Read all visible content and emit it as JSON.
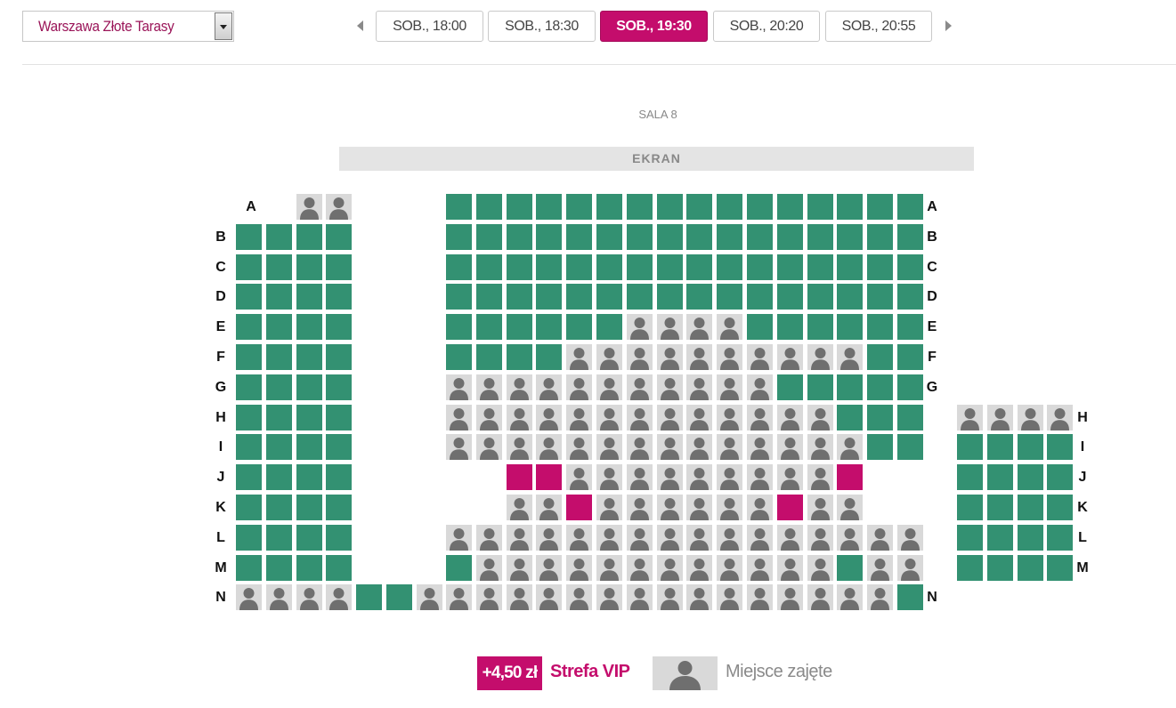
{
  "cinema_select": {
    "value": "Warszawa Złote Tarasy"
  },
  "showtimes": [
    {
      "label": "SOB., 18:00",
      "active": false
    },
    {
      "label": "SOB., 18:30",
      "active": false
    },
    {
      "label": "SOB., 19:30",
      "active": true
    },
    {
      "label": "SOB., 20:20",
      "active": false
    },
    {
      "label": "SOB., 20:55",
      "active": false
    }
  ],
  "hall": {
    "name": "SALA 8",
    "screen_label": "EKRAN"
  },
  "colors": {
    "free": "#339172",
    "vip": "#c40d6c",
    "taken": "#d9d9d9",
    "accent": "#c40d6c"
  },
  "seat_rows": [
    {
      "row": "A",
      "left": "..XX",
      "center": "FFFFFFFFFFFFFFFF",
      "right": ""
    },
    {
      "row": "B",
      "left": "FFFF",
      "center": "FFFFFFFFFFFFFFFF",
      "right": ""
    },
    {
      "row": "C",
      "left": "FFFF",
      "center": "FFFFFFFFFFFFFFFF",
      "right": ""
    },
    {
      "row": "D",
      "left": "FFFF",
      "center": "FFFFFFFFFFFFFFFF",
      "right": ""
    },
    {
      "row": "E",
      "left": "FFFF",
      "center": "FFFFFFXXXXFFFFFF",
      "right": ""
    },
    {
      "row": "F",
      "left": "FFFF",
      "center": "FFFFXXXXXXXXXXFF",
      "right": ""
    },
    {
      "row": "G",
      "left": "FFFF",
      "center": "XXXXXXXXXXXFFFFF",
      "right": ""
    },
    {
      "row": "H",
      "left": "FFFF",
      "center": "XXXXXXXXXXXXXFFF.",
      "right": "XXXX"
    },
    {
      "row": "I",
      "left": "FFFF",
      "center": "XXXXXXXXXXXXXXFF.",
      "right": "FFFF"
    },
    {
      "row": "J",
      "left": "FFFF",
      "center": "..VVXXXXXXXXXV...",
      "right": "FFFF"
    },
    {
      "row": "K",
      "left": "FFFF",
      "center": "..XXVXXXXXXVXX...",
      "right": "FFFF"
    },
    {
      "row": "L",
      "left": "FFFF",
      "center": "XXXXXXXXXXXXXXXX.",
      "right": "FFFF"
    },
    {
      "row": "M",
      "left": "FFFF",
      "center": "FXXXXXXXXXXXXFXX.",
      "right": "FFFF"
    },
    {
      "row": "N",
      "left": "XXXXFFX",
      "center": "XXXXXXXXXXXXXXXF",
      "right": ""
    }
  ],
  "legend": {
    "vip_badge": "+4,50 zł",
    "vip_label": "Strefa VIP",
    "taken_label": "Miejsce zajęte"
  }
}
